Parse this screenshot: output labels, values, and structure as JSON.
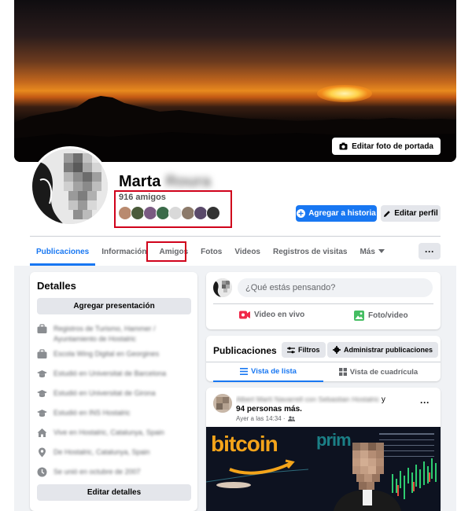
{
  "cover": {
    "edit_label": "Editar foto de portada"
  },
  "profile": {
    "first_name": "Marta",
    "last_name": "Roura",
    "friends_count": "916 amigos",
    "add_story_label": "Agregar a historia",
    "edit_profile_label": "Editar perfil"
  },
  "tabs": [
    {
      "label": "Publicaciones",
      "active": true
    },
    {
      "label": "Información"
    },
    {
      "label": "Amigos"
    },
    {
      "label": "Fotos"
    },
    {
      "label": "Videos"
    },
    {
      "label": "Registros de visitas"
    },
    {
      "label": "Más"
    }
  ],
  "more_label": "···",
  "details": {
    "title": "Detalles",
    "add_presentation_label": "Agregar presentación",
    "edit_details_label": "Editar detalles",
    "items": [
      {
        "icon": "briefcase-icon",
        "text": "Registros de Turismo, Hammer / Ayuntamiento de Hostalric"
      },
      {
        "icon": "briefcase-icon",
        "text": "Escola Wing Digital en Georgines"
      },
      {
        "icon": "graduation-cap-icon",
        "text": "Estudió en Universitat de Barcelona"
      },
      {
        "icon": "graduation-cap-icon",
        "text": "Estudió en Universitat de Girona"
      },
      {
        "icon": "graduation-cap-icon",
        "text": "Estudió en INS Hostalric"
      },
      {
        "icon": "home-icon",
        "text": "Vive en Hostalric, Catalunya, Spain"
      },
      {
        "icon": "location-pin-icon",
        "text": "De Hostalric, Catalunya, Spain"
      },
      {
        "icon": "clock-icon",
        "text": "Se unió en octubre de 2007"
      }
    ]
  },
  "composer": {
    "placeholder": "¿Qué estás pensando?",
    "live_label": "Video en vivo",
    "photo_label": "Foto/video"
  },
  "publications": {
    "title": "Publicaciones",
    "filters_label": "Filtros",
    "manage_label": "Administrar publicaciones",
    "list_view_label": "Vista de lista",
    "grid_view_label": "Vista de cuadrícula"
  },
  "post": {
    "tagged_names": "Albert Martí Navarrell con Sebastian Hostalric",
    "conjunction": "y",
    "people_count": "94 personas más.",
    "time": "Ayer a las 14:34 ·",
    "image_text_1": "bitcoin",
    "image_text_2": "prim"
  },
  "colors": {
    "accent": "#1877f2",
    "highlight_box": "#d0021b",
    "live_icon": "#f02849",
    "photo_icon": "#45bd62"
  }
}
